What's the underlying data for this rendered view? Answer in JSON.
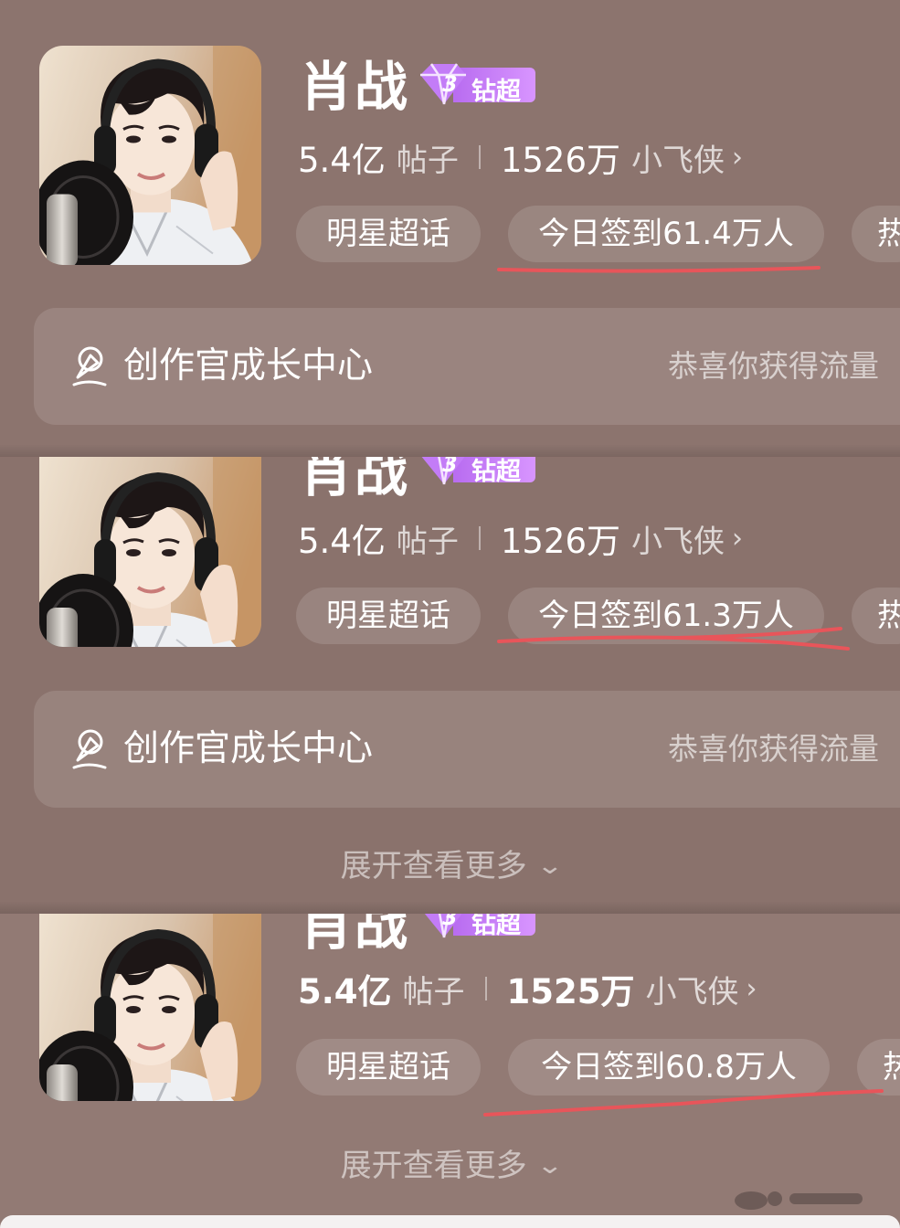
{
  "screens": [
    {
      "name": "肖战",
      "badge": {
        "level": "3",
        "label": "钻超"
      },
      "posts_count": "5.4亿",
      "posts_unit": "帖子",
      "fans_count": "1526万",
      "fans_unit": "小飞侠",
      "chip_category": "明星超话",
      "chip_checkin": "今日签到61.4万人",
      "chip_hot": "热",
      "creator_title": "创作官成长中心",
      "creator_note": "恭喜你获得流量"
    },
    {
      "name": "肖战",
      "badge": {
        "level": "3",
        "label": "钻超"
      },
      "posts_count": "5.4亿",
      "posts_unit": "帖子",
      "fans_count": "1526万",
      "fans_unit": "小飞侠",
      "chip_category": "明星超话",
      "chip_checkin": "今日签到61.3万人",
      "chip_hot": "热",
      "creator_title": "创作官成长中心",
      "creator_note": "恭喜你获得流量",
      "expand_label": "展开查看更多"
    },
    {
      "name": "肖战",
      "badge": {
        "level": "3",
        "label": "钻超"
      },
      "posts_count": "5.4亿",
      "posts_unit": "帖子",
      "fans_count": "1525万",
      "fans_unit": "小飞侠",
      "chip_category": "明星超话",
      "chip_checkin": "今日签到60.8万人",
      "chip_hot": "热",
      "expand_label": "展开查看更多"
    }
  ],
  "icons": {
    "badge": "diamond-icon",
    "creator": "creator-pen-icon",
    "expand": "chevron-down-icon",
    "stats_link": "chevron-right-icon",
    "back": "back-arrow-icon"
  },
  "colors": {
    "background": "#8c746e",
    "badge_purple": "#c07af5",
    "underline_red": "#e8555a",
    "text_primary": "#ffffff"
  }
}
